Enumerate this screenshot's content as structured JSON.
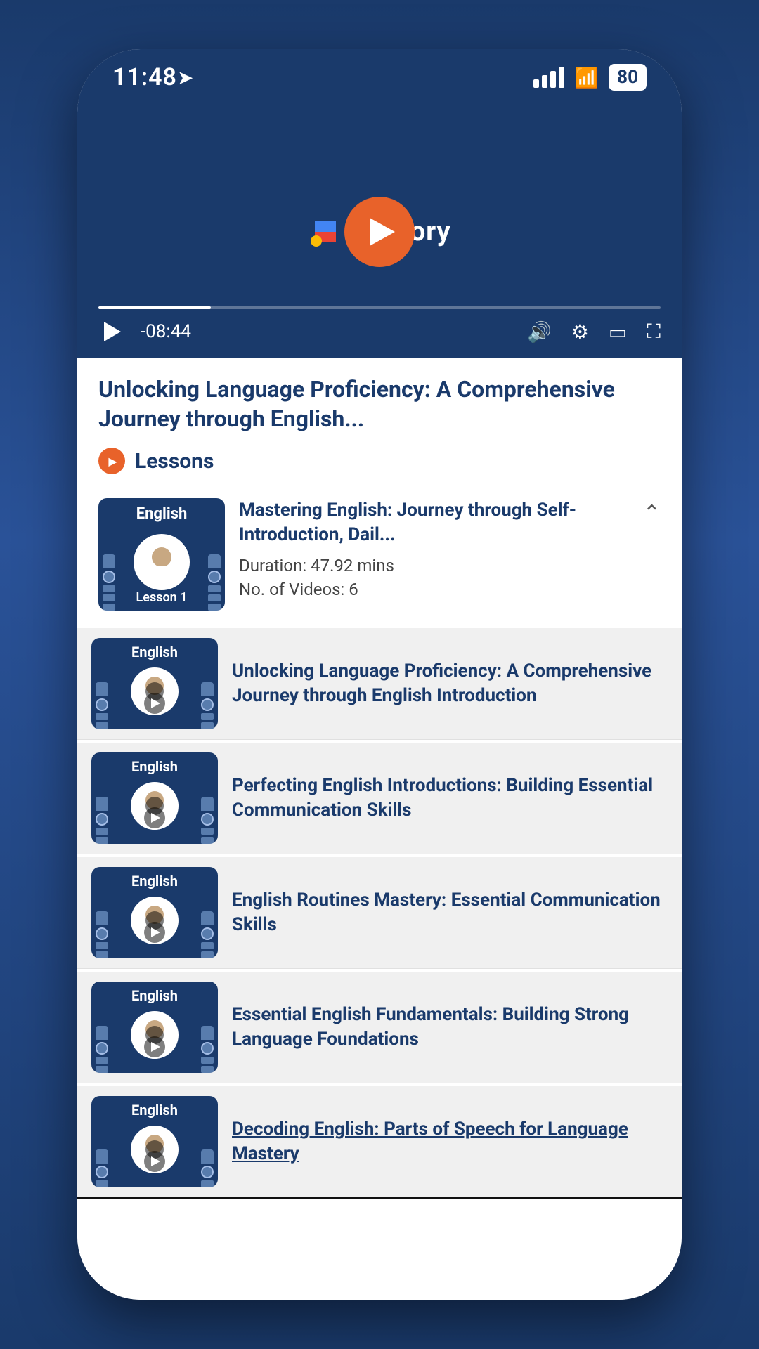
{
  "status": {
    "time": "11:48",
    "battery": "80"
  },
  "video": {
    "logo": "curiostory",
    "time_remaining": "-08:44",
    "progress_percent": 20
  },
  "course": {
    "title": "Unlocking Language Proficiency: A Comprehensive Journey through English...",
    "lessons_label": "Lessons"
  },
  "lesson1": {
    "label": "English",
    "lesson_number": "Lesson 1",
    "title": "Mastering English: Journey through Self-Introduction, Dail...",
    "duration": "Duration: 47.92 mins",
    "videos_count": "No. of Videos: 6"
  },
  "videos": [
    {
      "label": "English",
      "title": "Unlocking Language Proficiency: A Comprehensive Journey through English Introduction"
    },
    {
      "label": "English",
      "title": "Perfecting English Introductions: Building Essential Communication Skills"
    },
    {
      "label": "English",
      "title": "English Routines Mastery: Essential Communication Skills"
    },
    {
      "label": "English",
      "title": "Essential English Fundamentals: Building Strong Language Foundations"
    },
    {
      "label": "English",
      "title": "Decoding English: Parts of Speech for Language Mastery"
    }
  ]
}
